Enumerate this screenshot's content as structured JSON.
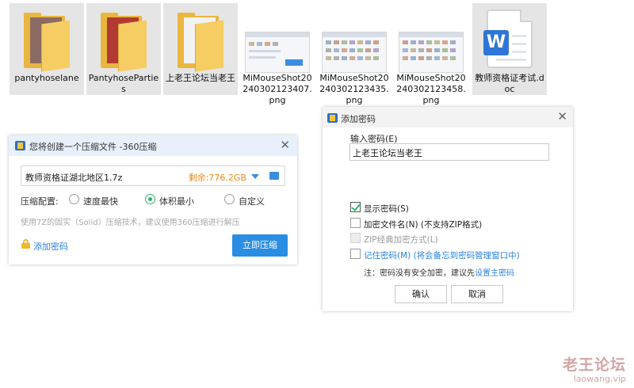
{
  "desktop": {
    "files": [
      {
        "name": "pantyhoselane",
        "type": "folder",
        "selected": true
      },
      {
        "name": "PantyhoseParties",
        "type": "folder",
        "selected": true
      },
      {
        "name": "上老王论坛当老王",
        "type": "folder",
        "selected": true
      },
      {
        "name": "MiMouseShot20240302123407.png",
        "type": "image",
        "selected": false
      },
      {
        "name": "MiMouseShot20240302123435.png",
        "type": "image",
        "selected": false
      },
      {
        "name": "MiMouseShot20240302123458.png",
        "type": "image",
        "selected": false
      },
      {
        "name": "教师资格证考试.doc",
        "type": "word",
        "selected": true
      }
    ]
  },
  "compress_dialog": {
    "title": "您将创建一个压缩文件 -360压缩",
    "close": "✕",
    "output_path": "教师资格证湖北地区1.7z",
    "free_space": "剩余:776.2GB",
    "config_label": "压缩配置:",
    "options": [
      "速度最快",
      "体积最小",
      "自定义"
    ],
    "selected_option": "体积最小",
    "hint": "使用7Z的固实（Solid）压缩技术，建议使用360压缩进行解压",
    "add_password": "添加密码",
    "compress_button": "立即压缩"
  },
  "password_dialog": {
    "title": "添加密码",
    "close": "✕",
    "input_label": "输入密码(E)",
    "password_value": "上老王论坛当老王",
    "checkboxes": [
      {
        "label": "显示密码(S)",
        "checked": true,
        "disabled": false
      },
      {
        "label": "加密文件名(N) (不支持ZIP格式)",
        "checked": false,
        "disabled": false
      },
      {
        "label": "ZIP经典加密方式(L)",
        "checked": false,
        "disabled": true
      },
      {
        "label": "记住密码(M) (将会备忘到密码管理窗口中)",
        "checked": false,
        "disabled": false
      }
    ],
    "note_prefix": "注：密码没有安全加密，建议先",
    "note_link": "设置主密码",
    "ok": "确认",
    "cancel": "取消"
  },
  "watermark": {
    "line1": "老王论坛",
    "line2": "laowang.vip"
  },
  "colors": {
    "accent": "#2a8de4",
    "radio_on": "#2bb673",
    "free_space": "#ee8a14",
    "folder": "#e9b640"
  }
}
